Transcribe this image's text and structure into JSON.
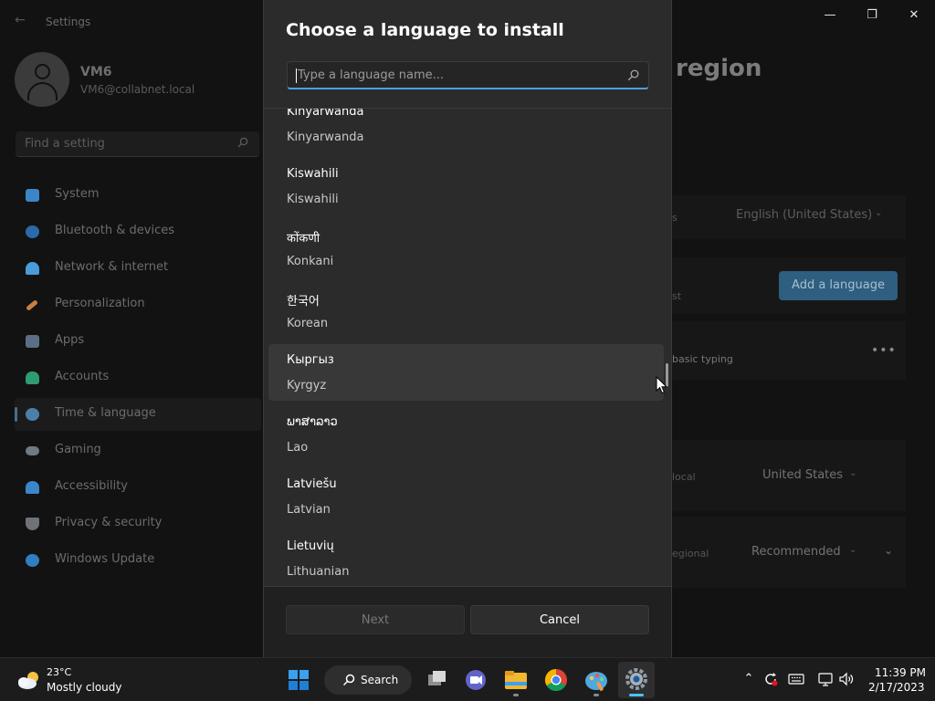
{
  "settings": {
    "app_title": "Settings",
    "profile": {
      "name": "VM6",
      "email": "VM6@collabnet.local"
    },
    "search_placeholder": "Find a setting",
    "nav": [
      {
        "label": "System",
        "icon": "monitor-icon",
        "color": "#3a86c8"
      },
      {
        "label": "Bluetooth & devices",
        "icon": "bluetooth-icon",
        "color": "#2b6aa8"
      },
      {
        "label": "Network & internet",
        "icon": "wifi-icon",
        "color": "#4a9bd8"
      },
      {
        "label": "Personalization",
        "icon": "brush-icon",
        "color": "#c9803c"
      },
      {
        "label": "Apps",
        "icon": "apps-icon",
        "color": "#5a6f86"
      },
      {
        "label": "Accounts",
        "icon": "person-icon",
        "color": "#2f9b73"
      },
      {
        "label": "Time & language",
        "icon": "globe-clock-icon",
        "color": "#4d7fa8",
        "selected": true
      },
      {
        "label": "Gaming",
        "icon": "controller-icon",
        "color": "#6f7a85"
      },
      {
        "label": "Accessibility",
        "icon": "accessibility-icon",
        "color": "#3a86c8"
      },
      {
        "label": "Privacy & security",
        "icon": "shield-icon",
        "color": "#6f7378"
      },
      {
        "label": "Windows Update",
        "icon": "update-icon",
        "color": "#2f7ec0"
      }
    ],
    "page_heading": "region",
    "background": {
      "display_language_value": "English (United States)",
      "add_language_label": "Add a language",
      "basic_typing_text": "basic typing",
      "country_label": "local",
      "country_value": "United States",
      "regional_label": "egional",
      "regional_value": "Recommended",
      "partial_s": "s",
      "partial_st": "st"
    }
  },
  "dialog": {
    "title": "Choose a language to install",
    "search_placeholder": "Type a language name...",
    "languages": [
      {
        "native": "Kinyarwanda",
        "english": "Kinyarwanda"
      },
      {
        "native": "Kiswahili",
        "english": "Kiswahili"
      },
      {
        "native": "कोंकणी",
        "english": "Konkani"
      },
      {
        "native": "한국어",
        "english": "Korean"
      },
      {
        "native": "Кыргыз",
        "english": "Kyrgyz",
        "hover": true
      },
      {
        "native": "ພາສາລາວ",
        "english": "Lao"
      },
      {
        "native": "Latviešu",
        "english": "Latvian"
      },
      {
        "native": "Lietuvių",
        "english": "Lithuanian"
      }
    ],
    "next_label": "Next",
    "cancel_label": "Cancel"
  },
  "taskbar": {
    "weather": {
      "temp": "23°C",
      "condition": "Mostly cloudy"
    },
    "search_label": "Search",
    "apps": [
      "start-icon",
      "task-view-icon",
      "teams-chat-icon",
      "file-explorer-icon",
      "chrome-icon",
      "paint-icon",
      "settings-icon"
    ],
    "clock": {
      "time": "11:39 PM",
      "date": "2/17/2023"
    }
  }
}
